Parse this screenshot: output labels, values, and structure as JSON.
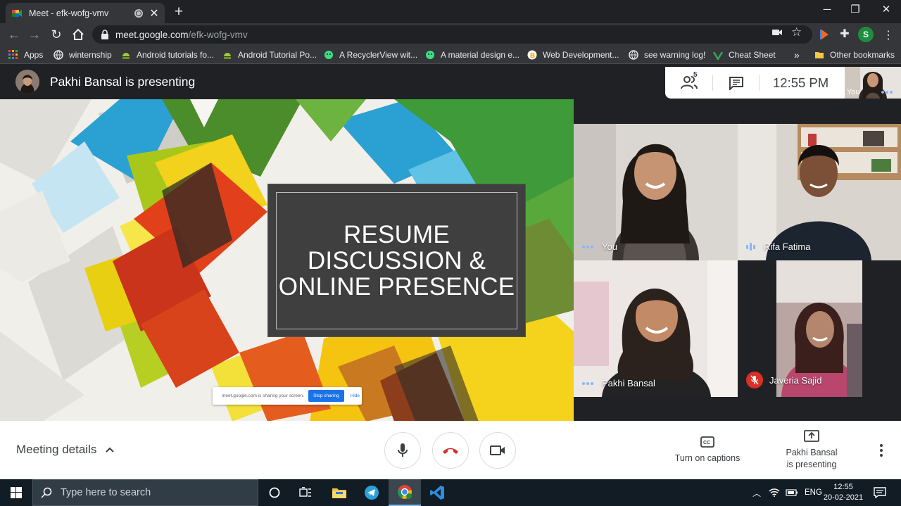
{
  "browser": {
    "tab_title": "Meet - efk-wofg-vmv",
    "new_tab": "+",
    "url_host": "meet.google.com",
    "url_path": "/efk-wofg-vmv",
    "profile_initial": "S",
    "bookmarks": [
      {
        "label": "Apps",
        "icon": "apps-grid-icon"
      },
      {
        "label": "winternship",
        "icon": "globe-icon"
      },
      {
        "label": "Android tutorials fo...",
        "icon": "android-icon"
      },
      {
        "label": "Android Tutorial Po...",
        "icon": "android-icon"
      },
      {
        "label": "A RecyclerView wit...",
        "icon": "android-icon"
      },
      {
        "label": "A material design e...",
        "icon": "android-icon"
      },
      {
        "label": "Web Development...",
        "icon": "b-icon"
      },
      {
        "label": "see warning log!",
        "icon": "globe-icon"
      },
      {
        "label": "Cheat Sheet",
        "icon": "cheat-sheet-icon"
      }
    ],
    "bookmarks_overflow": "»",
    "other_bookmarks": "Other bookmarks"
  },
  "meet": {
    "presenting_banner": "Pakhi Bansal is presenting",
    "participant_count": "5",
    "clock": "12:55  PM",
    "self_label": "You",
    "slide": {
      "title_line1": "RESUME",
      "title_line2": "DISCUSSION &",
      "title_line3": "ONLINE PRESENCE"
    },
    "share_notice": {
      "message": "meet.google.com is sharing your screen.",
      "stop_label": "Stop sharing",
      "hide_label": "Hide"
    },
    "participants": [
      {
        "name": "You",
        "indicator": "dots"
      },
      {
        "name": "Rifa Fatima",
        "indicator": "bars"
      },
      {
        "name": "Pakhi Bansal",
        "indicator": "dots"
      },
      {
        "name": "Javeria Sajid",
        "indicator": "muted"
      }
    ],
    "toolbar": {
      "meeting_details": "Meeting details",
      "captions_label": "Turn on captions",
      "presenting_line1": "Pakhi Bansal",
      "presenting_line2": "is presenting"
    },
    "colors": {
      "hangup_red": "#d93025",
      "accent_blue": "#1a73e8",
      "audio_blue": "#8ab4f8"
    }
  },
  "taskbar": {
    "search_placeholder": "Type here to search",
    "language": "ENG",
    "time": "12:55",
    "date": "20-02-2021"
  }
}
